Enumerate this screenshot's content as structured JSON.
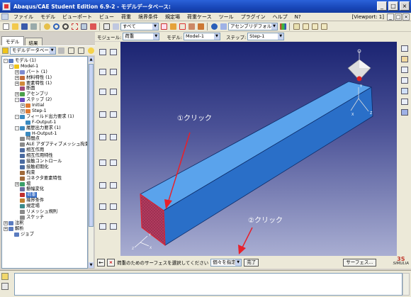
{
  "window": {
    "title": "Abaqus/CAE Student Edition 6.9-2 - モデルデータベース:",
    "viewport_title": "[Viewport: 1]",
    "buttons": {
      "minimize": "_",
      "maximize": "□",
      "close": "×"
    }
  },
  "menubar": {
    "items": [
      "ファイル",
      "モデル",
      "ビューポート",
      "ビュー",
      "荷重",
      "境界条件",
      "規定場",
      "荷重ケース",
      "ツール",
      "プラグイン",
      "ヘルプ",
      "N?"
    ]
  },
  "toolbar": {
    "filter_select": "すべて",
    "assembly_default": "アセンブリデフォルト"
  },
  "context": {
    "module_label": "モジュール:",
    "module_value": "荷重",
    "model_label": "モデル:",
    "model_value": "Model-1",
    "step_label": "ステップ:",
    "step_value": "Step-1"
  },
  "left_panel": {
    "tabs": [
      "モデル",
      "結果"
    ],
    "tree_select": "モデルデータベース",
    "tree": [
      {
        "indent": 0,
        "exp": "-",
        "icon": "#5a7bbf",
        "label": "モデル (1)"
      },
      {
        "indent": 1,
        "exp": "-",
        "icon": "#f0c419",
        "label": "Model-1"
      },
      {
        "indent": 2,
        "exp": "+",
        "icon": "#7d8ad0",
        "label": "パート (1)"
      },
      {
        "indent": 2,
        "exp": "+",
        "icon": "#c46b3a",
        "label": "材料特性 (1)"
      },
      {
        "indent": 2,
        "exp": "+",
        "icon": "#d08a3a",
        "label": "要素特性 (1)"
      },
      {
        "indent": 2,
        "exp": "",
        "icon": "#a04a7a",
        "label": "断面"
      },
      {
        "indent": 2,
        "exp": "+",
        "icon": "#4aa04a",
        "label": "アセンブリ"
      },
      {
        "indent": 2,
        "exp": "-",
        "icon": "#6a4ac0",
        "label": "ステップ (2)"
      },
      {
        "indent": 3,
        "exp": "+",
        "icon": "#e07b32",
        "label": "Initial"
      },
      {
        "indent": 3,
        "exp": "+",
        "icon": "#e07b32",
        "label": "Step-1"
      },
      {
        "indent": 2,
        "exp": "-",
        "icon": "#3a8ac0",
        "label": "フィールド出力要求 (1)"
      },
      {
        "indent": 3,
        "exp": "",
        "icon": "#3a8ac0",
        "label": "F-Output-1"
      },
      {
        "indent": 2,
        "exp": "-",
        "icon": "#3a8ac0",
        "label": "履歴出力要求 (1)"
      },
      {
        "indent": 3,
        "exp": "",
        "icon": "#3a8ac0",
        "label": "H-Output-1"
      },
      {
        "indent": 2,
        "exp": "",
        "icon": "#8a8a8a",
        "label": "時間点"
      },
      {
        "indent": 2,
        "exp": "",
        "icon": "#8a8a8a",
        "label": "ALE アダプティブメッシュ拘束"
      },
      {
        "indent": 2,
        "exp": "",
        "icon": "#4a6aa0",
        "label": "相互作用"
      },
      {
        "indent": 2,
        "exp": "",
        "icon": "#4a6aa0",
        "label": "相互作用特性"
      },
      {
        "indent": 2,
        "exp": "",
        "icon": "#4a6aa0",
        "label": "接触コントロール"
      },
      {
        "indent": 2,
        "exp": "",
        "icon": "#4a6aa0",
        "label": "接触初期化"
      },
      {
        "indent": 2,
        "exp": "",
        "icon": "#a06a3a",
        "label": "拘束"
      },
      {
        "indent": 2,
        "exp": "",
        "icon": "#a06a3a",
        "label": "コネクタ要素特性"
      },
      {
        "indent": 2,
        "exp": "+",
        "icon": "#3aa06a",
        "label": "場"
      },
      {
        "indent": 2,
        "exp": "",
        "icon": "#6a6aa0",
        "label": "振幅変化"
      },
      {
        "indent": 2,
        "exp": "",
        "icon": "#c03030",
        "label": "荷重",
        "selected": true
      },
      {
        "indent": 2,
        "exp": "",
        "icon": "#c08030",
        "label": "境界条件"
      },
      {
        "indent": 2,
        "exp": "",
        "icon": "#3a8a8a",
        "label": "規定場"
      },
      {
        "indent": 2,
        "exp": "",
        "icon": "#8a8a8a",
        "label": "リメッシュ規則"
      },
      {
        "indent": 2,
        "exp": "",
        "icon": "#8a8a8a",
        "label": "スケッチ"
      },
      {
        "indent": 0,
        "exp": "+",
        "icon": "#5a7bbf",
        "label": "注釈"
      },
      {
        "indent": 0,
        "exp": "+",
        "icon": "#5a7bbf",
        "label": "解析"
      },
      {
        "indent": 1,
        "exp": "",
        "icon": "#5a7bbf",
        "label": "ジョブ"
      }
    ]
  },
  "viewport": {
    "annotation_1": "①クリック",
    "annotation_2": "②クリック",
    "triad_labels": {
      "x": "X",
      "y": "Y",
      "z": "Z"
    },
    "local_triad": {
      "x": "X",
      "y": "Y",
      "z": "Z"
    },
    "colors": {
      "beam": "#2f80d8",
      "face_highlight": "#a0304a",
      "arrow": "#e8202a"
    }
  },
  "prompt": {
    "text": "荷重のためのサーフェスを選択してください",
    "select_value": "個々を指定",
    "done_button": "完了",
    "surface_button": "サーフェス..."
  },
  "brand": {
    "logo_mark": "3S",
    "logo_text": "SIMULIA"
  }
}
